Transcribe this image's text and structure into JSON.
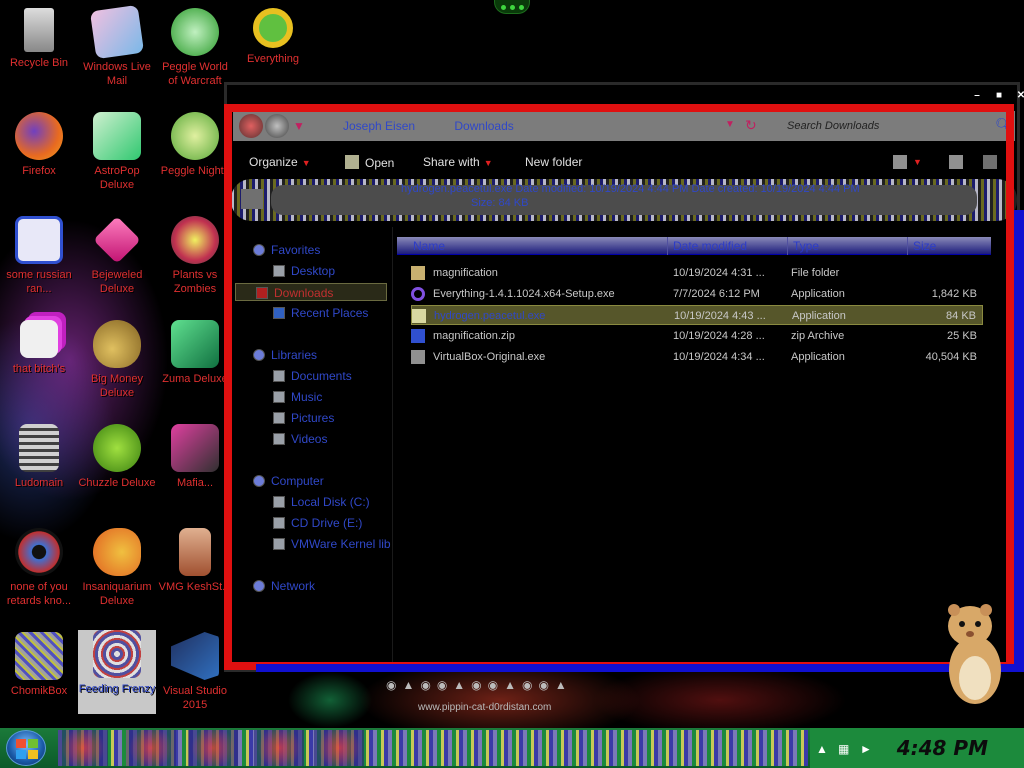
{
  "desktop": {
    "icons": [
      {
        "label": "Recycle Bin",
        "icon": "recycle-bin-icon",
        "color": "#c0c0c0"
      },
      {
        "label": "Windows Live Mail",
        "icon": "mail-icon",
        "color": "#7ab8e8"
      },
      {
        "label": "Peggle World of Warcraft",
        "icon": "peggle-icon",
        "color": "#5ac85a"
      },
      {
        "label": "Everything",
        "icon": "magnifier-icon",
        "color": "#e8c020"
      },
      {
        "label": "Firefox",
        "icon": "firefox-icon",
        "color": "#e86a20"
      },
      {
        "label": "AstroPop Deluxe",
        "icon": "astropop-icon",
        "color": "#30c870"
      },
      {
        "label": "Peggle Nights",
        "icon": "peggle-nights-icon",
        "color": "#58a838"
      },
      {
        "label": "some russian ran...",
        "icon": "de-app-icon",
        "color": "#3050d0"
      },
      {
        "label": "Bejeweled Deluxe",
        "icon": "gem-icon",
        "color": "#e030a0"
      },
      {
        "label": "Plants vs Zombies",
        "icon": "plants-icon",
        "color": "#d0d030"
      },
      {
        "label": "that bitch's",
        "icon": "stack-icon",
        "color": "#e040e0"
      },
      {
        "label": "Big Money Deluxe",
        "icon": "moneybag-icon",
        "color": "#c8a030"
      },
      {
        "label": "Zuma Deluxe",
        "icon": "zuma-icon",
        "color": "#30b060"
      },
      {
        "label": "Ludomain",
        "icon": "document-icon",
        "color": "#909090"
      },
      {
        "label": "Chuzzle Deluxe",
        "icon": "chuzzle-icon",
        "color": "#60c020"
      },
      {
        "label": "Insaniquarium Deluxe",
        "icon": "fish-icon",
        "color": "#e09020"
      },
      {
        "label": "none of you retards kno...",
        "icon": "record-icon",
        "color": "#4070d0"
      },
      {
        "label": "VMG KeshSt...",
        "icon": "vmg-file-icon",
        "color": "#c07040"
      },
      {
        "label": "ChomikBox",
        "icon": "chomikbox-icon",
        "color": "#909090"
      },
      {
        "label": "Feeding Frenzy",
        "icon": "frenzy-icon",
        "color": "#d0d0d0"
      },
      {
        "label": "Visual Studio 2015",
        "icon": "visual-studio-icon",
        "color": "#3070c0"
      },
      {
        "label": "Mafia...",
        "icon": "game-icon",
        "color": "#b03070"
      }
    ]
  },
  "explorer": {
    "address": {
      "crumbs": [
        "Joseph Eisen",
        "Downloads"
      ],
      "search_placeholder": "Search Downloads"
    },
    "toolbar": {
      "organize": "Organize",
      "open": "Open",
      "share_with": "Share with",
      "new_folder": "New folder"
    },
    "preview": {
      "line1": "hydrogen.peacetul.exe    Date modified: 10/19/2024 4:44 PM          Date created: 10/19/2024 4:44 PM",
      "line2": "Size: 84 KB"
    },
    "nav": {
      "favorites": "Favorites",
      "desktop": "Desktop",
      "downloads": "Downloads",
      "recent_places": "Recent Places",
      "libraries": "Libraries",
      "documents": "Documents",
      "music": "Music",
      "pictures": "Pictures",
      "videos": "Videos",
      "computer": "Computer",
      "local_disk": "Local Disk (C:)",
      "cd_drive": "CD Drive (E:)",
      "vmware": "VMWare Kernel lib",
      "network": "Network"
    },
    "columns": {
      "name": "Name",
      "date": "Date modified",
      "type": "Type",
      "size": "Size"
    },
    "files": [
      {
        "name": "magnification",
        "date": "10/19/2024 4:31 ...",
        "type": "File folder",
        "size": "",
        "icon": "folder-icon"
      },
      {
        "name": "Everything-1.4.1.1024.x64-Setup.exe",
        "date": "7/7/2024 6:12 PM",
        "type": "Application",
        "size": "1,842 KB",
        "icon": "everything-setup-icon"
      },
      {
        "name": "hydrogen.peacetul.exe",
        "date": "10/19/2024 4:43 ...",
        "type": "Application",
        "size": "84 KB",
        "icon": "exe-icon"
      },
      {
        "name": "magnification.zip",
        "date": "10/19/2024 4:28 ...",
        "type": "zip Archive",
        "size": "25 KB",
        "icon": "zip-icon"
      },
      {
        "name": "VirtualBox-Original.exe",
        "date": "10/19/2024 4:34 ...",
        "type": "Application",
        "size": "40,504 KB",
        "icon": "virtualbox-icon"
      }
    ]
  },
  "bottom": {
    "site": "www.pippin-cat-d0rdistan.com"
  },
  "taskbar": {
    "clock": "4:48 PM",
    "accent": "#1c8a3c"
  }
}
